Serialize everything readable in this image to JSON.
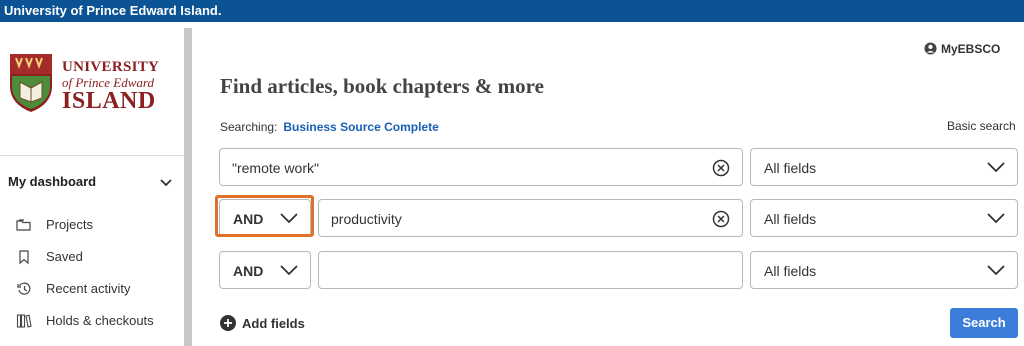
{
  "topbar": {
    "title": "University of Prince Edward Island."
  },
  "logo": {
    "line1": "UNIVERSITY",
    "line2": "of Prince Edward",
    "line3": "ISLAND"
  },
  "sidebar": {
    "dashboard_label": "My dashboard",
    "items": [
      {
        "label": "Projects",
        "icon": "folder-icon"
      },
      {
        "label": "Saved",
        "icon": "bookmark-icon"
      },
      {
        "label": "Recent activity",
        "icon": "history-icon"
      },
      {
        "label": "Holds & checkouts",
        "icon": "books-icon"
      }
    ]
  },
  "header": {
    "title": "Find articles, book chapters & more",
    "account_label": "MyEBSCO"
  },
  "searching": {
    "label": "Searching:",
    "database": "Business Source Complete",
    "basic_search": "Basic search"
  },
  "rows": [
    {
      "query": "\"remote work\"",
      "field": "All fields"
    },
    {
      "operator": "AND",
      "query": "productivity",
      "field": "All fields"
    },
    {
      "operator": "AND",
      "query": "",
      "field": "All fields"
    }
  ],
  "actions": {
    "add_fields": "Add fields",
    "search": "Search"
  },
  "colors": {
    "topbar": "#0b5394",
    "link": "#1a5fb4",
    "button": "#3b7dd8",
    "highlight": "#e0702a"
  }
}
